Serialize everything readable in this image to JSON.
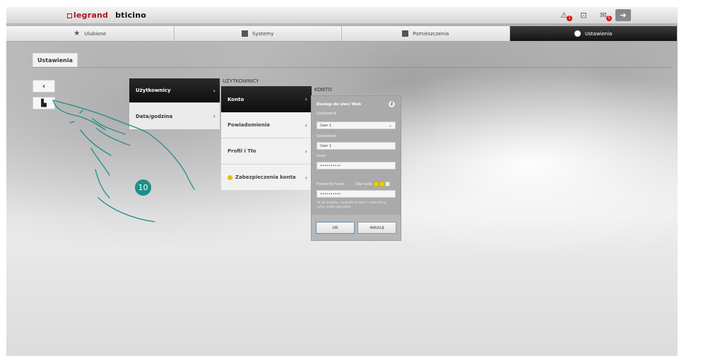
{
  "brand": {
    "legrand": "legrand",
    "bticino": "bticino"
  },
  "topbar": {
    "icons": [
      {
        "name": "alert-icon",
        "badge": "1"
      },
      {
        "name": "lock-icon",
        "badge": ""
      },
      {
        "name": "mail-icon",
        "badge": "5"
      },
      {
        "name": "logout-icon",
        "badge": ""
      }
    ]
  },
  "nav": {
    "tabs": [
      {
        "label": "Ulubione",
        "icon": "star-icon"
      },
      {
        "label": "Systemy",
        "icon": "systems-icon"
      },
      {
        "label": "Pomieszczenia",
        "icon": "rooms-icon"
      },
      {
        "label": "Ustawienia",
        "icon": "settings-icon",
        "active": true
      }
    ]
  },
  "page": {
    "title": "Ustawienia"
  },
  "side": {
    "back_glyph": "‹",
    "save_glyph": "▙"
  },
  "menu1": {
    "items": [
      {
        "label": "Użytkownicy",
        "active": true
      },
      {
        "label": "Data/godzina",
        "active": false
      }
    ],
    "chevron": "›"
  },
  "menu2": {
    "header": "UŻYTKOWNICY",
    "items": [
      {
        "label": "Konto",
        "active": true
      },
      {
        "label": "Powiadomienia"
      },
      {
        "label": "Profil i Tło"
      },
      {
        "label": "Zabezpieczenia konta",
        "dot_color": "#e6c100"
      }
    ]
  },
  "konto": {
    "header": "KONTO",
    "title": "Dostęp do sieci Web",
    "info": "i",
    "user_select_label": "Użytkownik",
    "user_select_value": "User 1",
    "user_field_label": "Użytkownik",
    "user_field_value": "User 1",
    "password_label": "hasło",
    "password_value": "••••••••••",
    "confirm_label": "Potwierdź hasło",
    "strength_label": "Siła hasła",
    "strength_level": 2,
    "strength_max": 3,
    "confirm_value": "••••••••••",
    "hint": "*8-16 znaków, dozwolone duże i małe litery, cyfry, znaki specjalne",
    "ok_label": "OK",
    "cancel_label": "ANULUJ"
  },
  "callout": {
    "number": "10"
  },
  "colors": {
    "accent": "#1c8f8a",
    "brand_red": "#b3121b",
    "active_tab": "#141414"
  }
}
